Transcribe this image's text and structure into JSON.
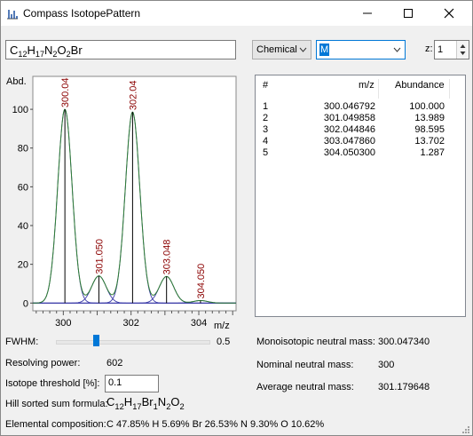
{
  "window": {
    "title": "Compass IsotopePattern"
  },
  "toolbar": {
    "formula": {
      "parts": [
        [
          "C",
          "12"
        ],
        [
          "H",
          "17"
        ],
        [
          "N",
          "2"
        ],
        [
          "O",
          "2"
        ],
        [
          "Br",
          ""
        ]
      ]
    },
    "mode_select": "Chemical",
    "element_select": "M",
    "charge_label": "z:",
    "charge_value": "1"
  },
  "chart_data": {
    "type": "line",
    "title": "",
    "xlabel": "m/z",
    "ylabel": "Abd.",
    "xlim": [
      299.1,
      305.1
    ],
    "ylim": [
      -4,
      117
    ],
    "xticks": [
      300,
      302,
      304
    ],
    "yticks": [
      0,
      20,
      40,
      60,
      80,
      100
    ],
    "peaks": [
      {
        "mz": 300.046792,
        "abundance": 100.0,
        "label": "300.04"
      },
      {
        "mz": 301.049858,
        "abundance": 13.989,
        "label": "301.050"
      },
      {
        "mz": 302.044846,
        "abundance": 98.595,
        "label": "302.04"
      },
      {
        "mz": 303.04786,
        "abundance": 13.702,
        "label": "303.048"
      },
      {
        "mz": 304.0503,
        "abundance": 1.287,
        "label": "304.050"
      }
    ],
    "series": [
      {
        "name": "envelope",
        "color": "#2e7d32"
      },
      {
        "name": "peaks",
        "color": "#3a3aa8"
      },
      {
        "name": "sticks",
        "color": "#000000"
      }
    ]
  },
  "table": {
    "headers": [
      "#",
      "m/z",
      "Abundance"
    ],
    "rows": [
      [
        "1",
        "300.046792",
        "100.000"
      ],
      [
        "2",
        "301.049858",
        "13.989"
      ],
      [
        "3",
        "302.044846",
        "98.595"
      ],
      [
        "4",
        "303.047860",
        "13.702"
      ],
      [
        "5",
        "304.050300",
        "1.287"
      ]
    ]
  },
  "params": {
    "fwhm_label": "FWHM:",
    "fwhm_value": "0.5",
    "fwhm_fraction": 0.26,
    "resolving_label": "Resolving power:",
    "resolving_value": "602",
    "threshold_label": "Isotope threshold [%]:",
    "threshold_value": "0.1",
    "hill_label": "Hill sorted sum formula:",
    "hill_parts": [
      [
        "C",
        "12"
      ],
      [
        "H",
        "17"
      ],
      [
        "Br",
        "1"
      ],
      [
        "N",
        "2"
      ],
      [
        "O",
        "2"
      ]
    ],
    "elemental_label": "Elemental composition:",
    "elemental_value": "C 47.85% H 5.69% Br 26.53% N 9.30% O 10.62%"
  },
  "masses": {
    "mono_label": "Monoisotopic neutral mass:",
    "mono_value": "300.047340",
    "nominal_label": "Nominal neutral mass:",
    "nominal_value": "300",
    "average_label": "Average neutral mass:",
    "average_value": "301.179648"
  }
}
